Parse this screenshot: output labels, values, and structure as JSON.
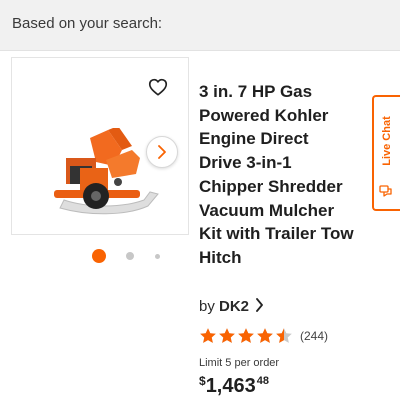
{
  "header": {
    "label": "Based on your search:"
  },
  "product": {
    "title": "3 in. 7 HP Gas\nPowered Kohler\nEngine Direct\nDrive 3-in-1\nChipper Shredder\nVacuum Mulcher\nKit with Trailer Tow\nHitch",
    "brand_prefix": "by",
    "brand": "DK2",
    "rating": 4.5,
    "rating_max": 5,
    "review_count": "(244)",
    "limit_text": "Limit 5 per order",
    "price": {
      "currency": "$",
      "whole": "1,463",
      "cents": "48"
    },
    "image_carousel": {
      "current": 1,
      "total": 3
    }
  },
  "live_chat": {
    "label": "Live Chat"
  },
  "colors": {
    "accent": "#f96302",
    "star_filled": "#f96302",
    "star_empty": "#c9c9c9",
    "header_bg": "#f1f1f1"
  },
  "icons": [
    "heart-icon",
    "chevron-right-icon",
    "star-icon",
    "chat-icon"
  ]
}
